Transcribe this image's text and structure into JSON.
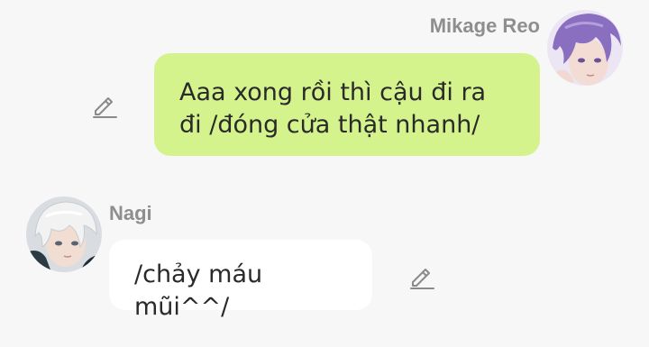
{
  "messages": [
    {
      "sender": "Mikage Reo",
      "side": "right",
      "text": "Aaa xong rồi thì cậu đi ra đi /đóng cửa thật nhanh/",
      "bubble_color": "#d5f38d",
      "icons": [
        "edit-icon"
      ]
    },
    {
      "sender": "Nagi",
      "side": "left",
      "text": "/chảy máu mũi^^/",
      "bubble_color": "#ffffff",
      "icons": [
        "edit-icon"
      ]
    }
  ],
  "colors": {
    "background": "#f7f7f7",
    "sender_name": "#8e8e8e",
    "icon": "#8a8a8a"
  }
}
